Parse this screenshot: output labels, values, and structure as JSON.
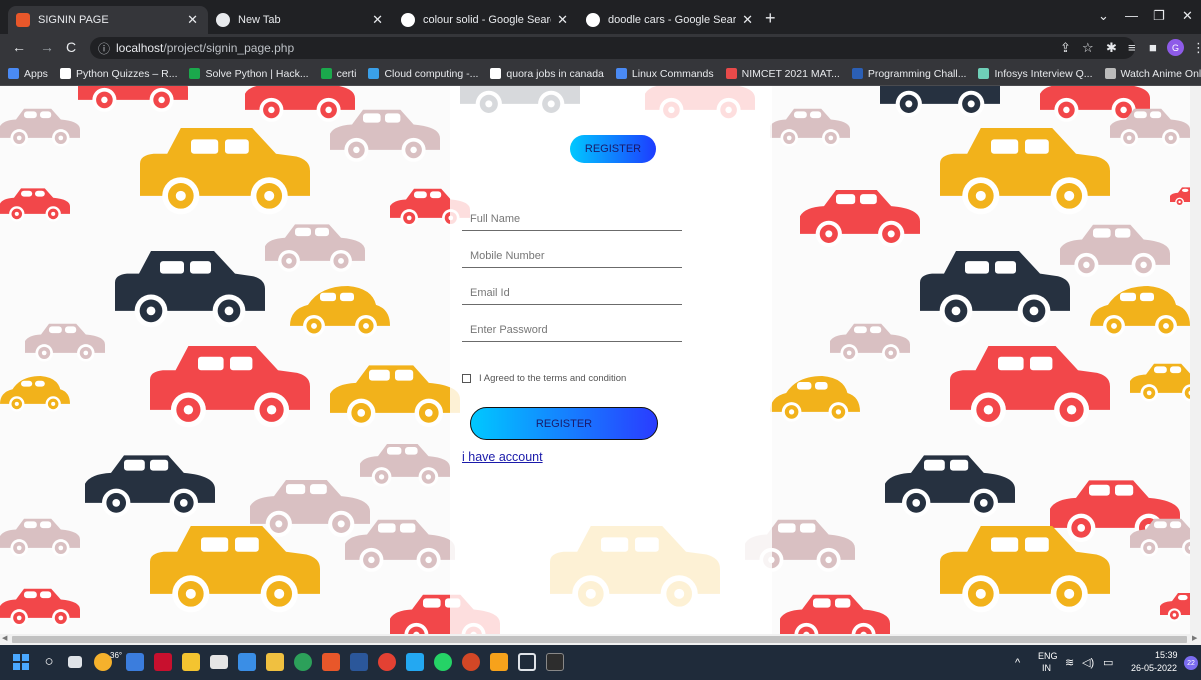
{
  "browser": {
    "tabs": [
      {
        "title": "SIGNIN PAGE",
        "active": true,
        "favicon_color": "#e8572a"
      },
      {
        "title": "New Tab",
        "active": false,
        "favicon_color": "#e8eaed"
      },
      {
        "title": "colour solid - Google Search",
        "active": false,
        "favicon_color": "#ffffff"
      },
      {
        "title": "doodle cars - Google Search",
        "active": false,
        "favicon_color": "#ffffff"
      }
    ],
    "url_host": "localhost",
    "url_path": "/project/signin_page.php",
    "profile_initial": "G",
    "bookmarks": [
      {
        "label": "Apps",
        "color": "#4a8af4"
      },
      {
        "label": "Python Quizzes – R...",
        "color": "#ffffff"
      },
      {
        "label": "Solve Python | Hack...",
        "color": "#1ba94c"
      },
      {
        "label": "certi",
        "color": "#1ba94c"
      },
      {
        "label": "Cloud computing -...",
        "color": "#3aa0e8"
      },
      {
        "label": "quora jobs in canada",
        "color": "#ffffff"
      },
      {
        "label": "Linux Commands",
        "color": "#4a8af4"
      },
      {
        "label": "NIMCET 2021 MAT...",
        "color": "#e84a4a"
      },
      {
        "label": "Programming Chall...",
        "color": "#2b5fb5"
      },
      {
        "label": "Infosys Interview Q...",
        "color": "#6fd0b8"
      },
      {
        "label": "Watch Anime Onlin...",
        "color": "#bbbbbb"
      }
    ]
  },
  "form": {
    "top_register_label": "REGISTER",
    "full_name_placeholder": "Full Name",
    "mobile_placeholder": "Mobile Number",
    "email_placeholder": "Email Id",
    "password_placeholder": "Enter Password",
    "terms_label": "I Agreed to the terms and condition",
    "register_label": "REGISTER",
    "have_account_label": "i have account"
  },
  "taskbar": {
    "weather": "36°",
    "language": "ENG",
    "region": "IN",
    "time": "15:39",
    "date": "26-05-2022",
    "notifications": "22"
  },
  "colors": {
    "car_red": "#f2474a",
    "car_yellow": "#f2b21b",
    "car_dark": "#263140",
    "car_pink": "#d9c0c2",
    "button_gradient_start": "#00c8ff",
    "button_gradient_end": "#2a3cff"
  }
}
